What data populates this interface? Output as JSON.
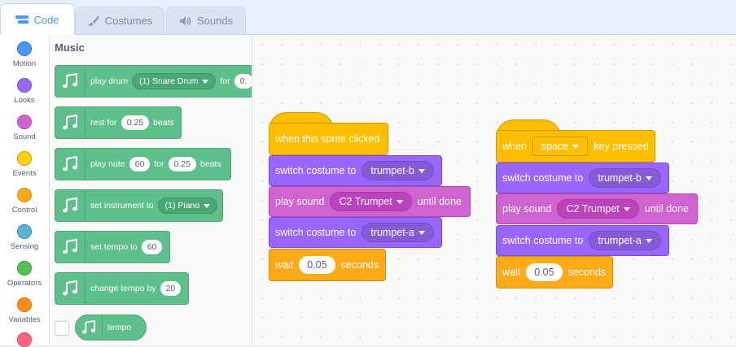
{
  "tabs": [
    {
      "label": "Code",
      "icon": "code-icon",
      "active": true
    },
    {
      "label": "Costumes",
      "icon": "paintbrush-icon",
      "active": false
    },
    {
      "label": "Sounds",
      "icon": "speaker-icon",
      "active": false
    }
  ],
  "categories": [
    {
      "label": "Motion",
      "color": "#4c97ff"
    },
    {
      "label": "Looks",
      "color": "#9966ff"
    },
    {
      "label": "Sound",
      "color": "#cf63cf"
    },
    {
      "label": "Events",
      "color": "#ffd500"
    },
    {
      "label": "Control",
      "color": "#ffab19"
    },
    {
      "label": "Sensing",
      "color": "#5cb1d6"
    },
    {
      "label": "Operators",
      "color": "#59c059"
    },
    {
      "label": "Variables",
      "color": "#ff8c1a"
    }
  ],
  "palette": {
    "title": "Music",
    "play_drum": {
      "label": "play drum",
      "drum": "(1) Snare Drum",
      "for": "for",
      "value": "0."
    },
    "rest_for": {
      "label": "rest for",
      "value": "0.25",
      "unit": "beats"
    },
    "play_note": {
      "label": "play note",
      "note": "60",
      "for": "for",
      "beats": "0.25",
      "unit": "beats"
    },
    "set_instrument": {
      "label": "set instrument to",
      "instrument": "(1) Piano"
    },
    "set_tempo": {
      "label": "set tempo to",
      "value": "60"
    },
    "change_tempo": {
      "label": "change tempo by",
      "value": "20"
    },
    "tempo_reporter": {
      "label": "tempo"
    }
  },
  "script1": {
    "hat": "when this sprite clicked",
    "b1": {
      "label": "switch costume to",
      "value": "trumpet-b"
    },
    "b2": {
      "label": "play sound",
      "value": "C2 Trumpet",
      "suffix": "until done"
    },
    "b3": {
      "label": "switch costume to",
      "value": "trumpet-a"
    },
    "b4": {
      "label": "wait",
      "value": "0.05",
      "suffix": "seconds"
    }
  },
  "script2": {
    "hat_prefix": "when",
    "hat_key": "space",
    "hat_suffix": "key pressed",
    "b1": {
      "label": "switch costume to",
      "value": "trumpet-b"
    },
    "b2": {
      "label": "play sound",
      "value": "C2 Trumpet",
      "suffix": "until done"
    },
    "b3": {
      "label": "switch costume to",
      "value": "trumpet-a"
    },
    "b4": {
      "label": "wait",
      "value": "0.05",
      "suffix": "seconds"
    }
  }
}
